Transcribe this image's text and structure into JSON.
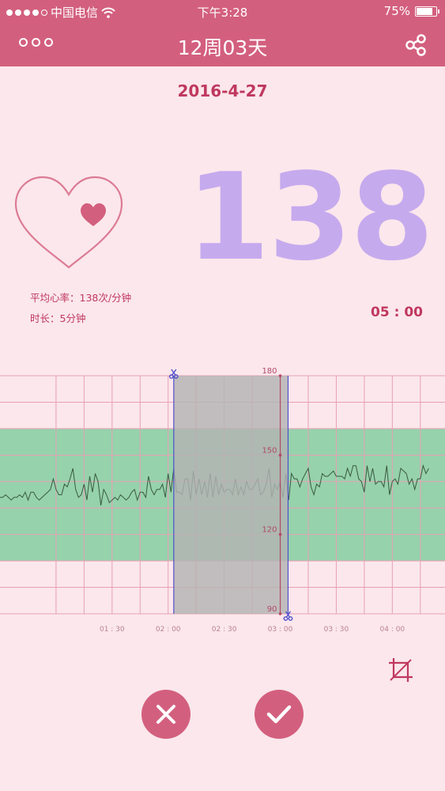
{
  "status_bar": {
    "carrier": "中国电信",
    "time": "下午3:28",
    "battery": "75%"
  },
  "nav": {
    "title": "12周03天",
    "more_icon": "more-icon",
    "share_icon": "share-icon"
  },
  "record": {
    "date": "2016-4-27",
    "bpm": "138",
    "avg_label": "平均心率：138次/分钟",
    "duration_label": "时长：5分钟",
    "timer": "05 : 00"
  },
  "colors": {
    "accent": "#d35f7e",
    "text_accent": "#c0385f",
    "bpm": "#c6aaee",
    "normal_band": "#96d2ac",
    "selection": "#b3b3b3",
    "cursor": "#5050cc"
  },
  "chart_data": {
    "type": "line",
    "x_ticks": [
      "01 : 30",
      "02 : 00",
      "02 : 30",
      "03 : 00",
      "03 : 30",
      "04 : 00"
    ],
    "x_tick_minutes": [
      1.5,
      2.0,
      2.5,
      3.0,
      3.5,
      4.0
    ],
    "xlim_minutes": [
      0.5,
      4.47
    ],
    "y_ticks": [
      90,
      120,
      150,
      180
    ],
    "ylim": [
      90,
      180
    ],
    "normal_band": [
      110,
      160
    ],
    "selection_minutes": [
      2.05,
      3.07
    ],
    "marker_minute": 3.0,
    "series": [
      {
        "x_start_minutes": 0.5,
        "x_step_minutes": 0.025,
        "values": [
          134,
          134,
          135,
          134,
          133,
          134,
          134,
          135,
          134,
          136,
          133,
          136,
          136,
          134,
          133,
          134,
          135,
          136,
          137,
          141,
          137,
          135,
          135,
          139,
          138,
          141,
          145,
          137,
          134,
          135,
          139,
          133,
          142,
          136,
          143,
          140,
          131,
          137,
          135,
          132,
          133,
          134,
          133,
          135,
          134,
          133,
          134,
          136,
          137,
          133,
          136,
          136,
          134,
          142,
          137,
          135,
          137,
          137,
          139,
          134,
          143,
          136,
          145,
          136,
          136,
          135,
          141,
          141,
          133,
          144,
          135,
          141,
          135,
          140,
          134,
          143,
          134,
          142,
          135,
          139,
          136,
          137,
          137,
          135,
          141,
          135,
          138,
          135,
          140,
          137,
          137,
          139,
          141,
          135,
          136,
          139,
          145,
          134,
          139,
          137,
          140,
          134,
          143,
          133,
          143,
          141,
          141,
          138,
          141,
          143,
          145,
          138,
          135,
          139,
          138,
          143,
          142,
          142,
          143,
          144,
          142,
          142,
          142,
          141,
          145,
          142,
          146,
          146,
          141,
          140,
          136,
          146,
          140,
          145,
          139,
          140,
          140,
          138,
          146,
          135,
          140,
          141,
          139,
          145,
          144,
          143,
          139,
          141,
          137,
          141,
          141,
          146,
          143,
          145
        ]
      }
    ]
  }
}
